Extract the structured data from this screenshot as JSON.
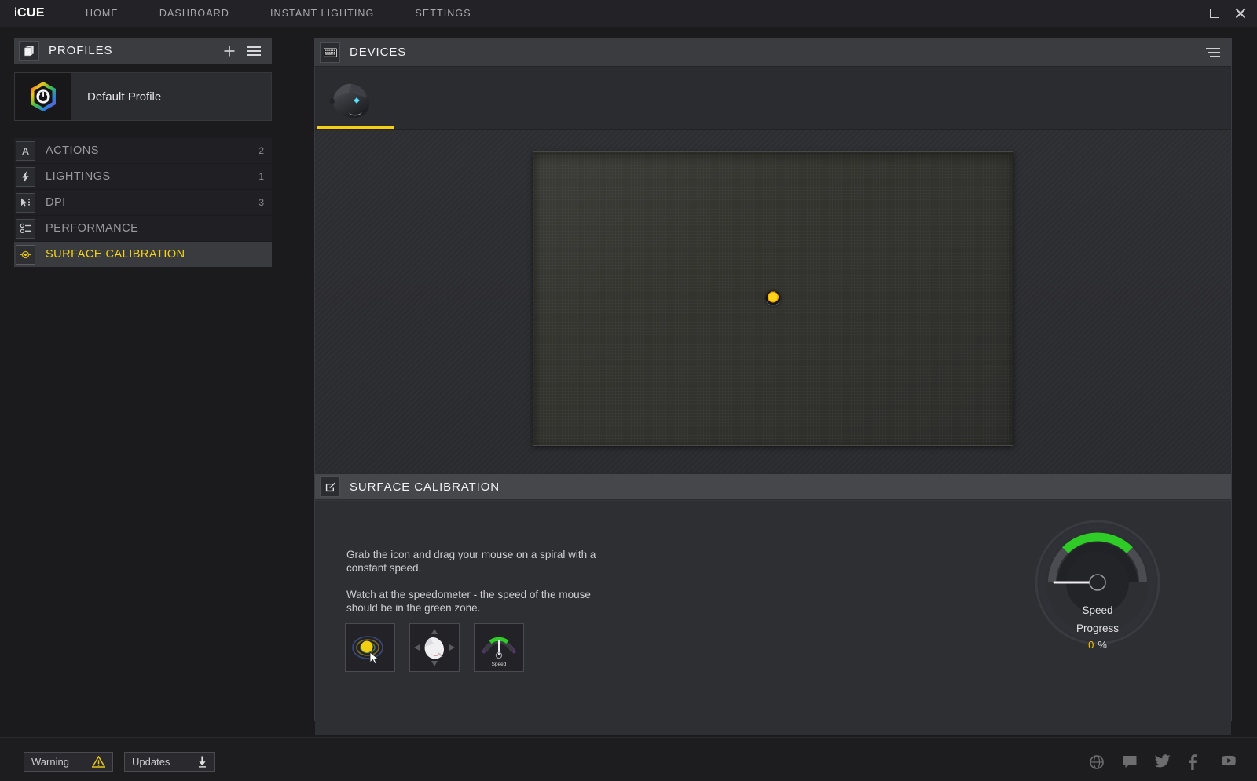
{
  "titlebar": {
    "logo_i": "i",
    "logo_cue": "CUE",
    "nav": [
      {
        "label": "HOME",
        "name": "nav-home"
      },
      {
        "label": "DASHBOARD",
        "name": "nav-dashboard"
      },
      {
        "label": "INSTANT LIGHTING",
        "name": "nav-instant-lighting"
      },
      {
        "label": "SETTINGS",
        "name": "nav-settings"
      }
    ],
    "window_controls": [
      "minimize",
      "maximize",
      "close"
    ]
  },
  "sidebar": {
    "header": {
      "title": "PROFILES",
      "icon": "profiles-stack-icon",
      "add_icon": "plus-icon",
      "menu_icon": "hamburger-menu-icon"
    },
    "profile": {
      "name": "Default Profile",
      "icon": "corsair-rainbow-hex-icon"
    },
    "categories": [
      {
        "label": "ACTIONS",
        "count": "2",
        "icon": "letter-a-icon",
        "active": false
      },
      {
        "label": "LIGHTINGS",
        "count": "1",
        "icon": "lightning-bolt-icon",
        "active": false
      },
      {
        "label": "DPI",
        "count": "3",
        "icon": "cursor-dpi-icon",
        "active": false
      },
      {
        "label": "PERFORMANCE",
        "count": "",
        "icon": "sliders-icon",
        "active": false
      },
      {
        "label": "SURFACE CALIBRATION",
        "count": "",
        "icon": "crosshair-target-icon",
        "active": true
      }
    ]
  },
  "main": {
    "devices_header": {
      "title": "DEVICES",
      "icon": "keyboard-icon",
      "menu_icon": "list-menu-icon"
    },
    "device_tabs": [
      {
        "name": "device-tab-mouse",
        "icon": "gaming-mouse-icon",
        "selected": true
      }
    ],
    "calibration_pad": {
      "name": "calibration-surface-area",
      "target_dot": "draggable-yellow-dot"
    },
    "surface_calibration": {
      "header_title": "SURFACE CALIBRATION",
      "header_icon": "edit-pencil-square-icon",
      "instruction_1": "Grab the icon and drag your mouse on a spiral with a constant speed.",
      "instruction_2": "Watch at the speedometer - the speed of the mouse should be in the green zone.",
      "thumbnails": [
        {
          "name": "thumb-drag-dot",
          "icon": "yellow-dot-with-cursor-icon"
        },
        {
          "name": "thumb-mouse-directions",
          "icon": "mouse-with-arrows-icon"
        },
        {
          "name": "thumb-speedometer",
          "icon": "speedometer-icon",
          "caption": "Speed"
        }
      ],
      "gauge": {
        "speed_label": "Speed",
        "progress_label": "Progress",
        "progress_value": "0",
        "progress_unit": "%",
        "green_zone_color": "#2fcc28",
        "needle_angle_deg": 180
      }
    }
  },
  "statusbar": {
    "warning_button": {
      "label": "Warning",
      "icon": "warning-triangle-icon",
      "color": "#e8c419"
    },
    "updates_button": {
      "label": "Updates",
      "icon": "download-arrow-icon"
    },
    "social": [
      {
        "name": "corsair-link-icon"
      },
      {
        "name": "forum-chat-icon"
      },
      {
        "name": "twitter-icon"
      },
      {
        "name": "facebook-icon"
      },
      {
        "name": "youtube-icon"
      }
    ]
  },
  "colors": {
    "accent_yellow": "#f5d414",
    "panel_header": "#3b3c40",
    "background": "#1b1b1e"
  }
}
